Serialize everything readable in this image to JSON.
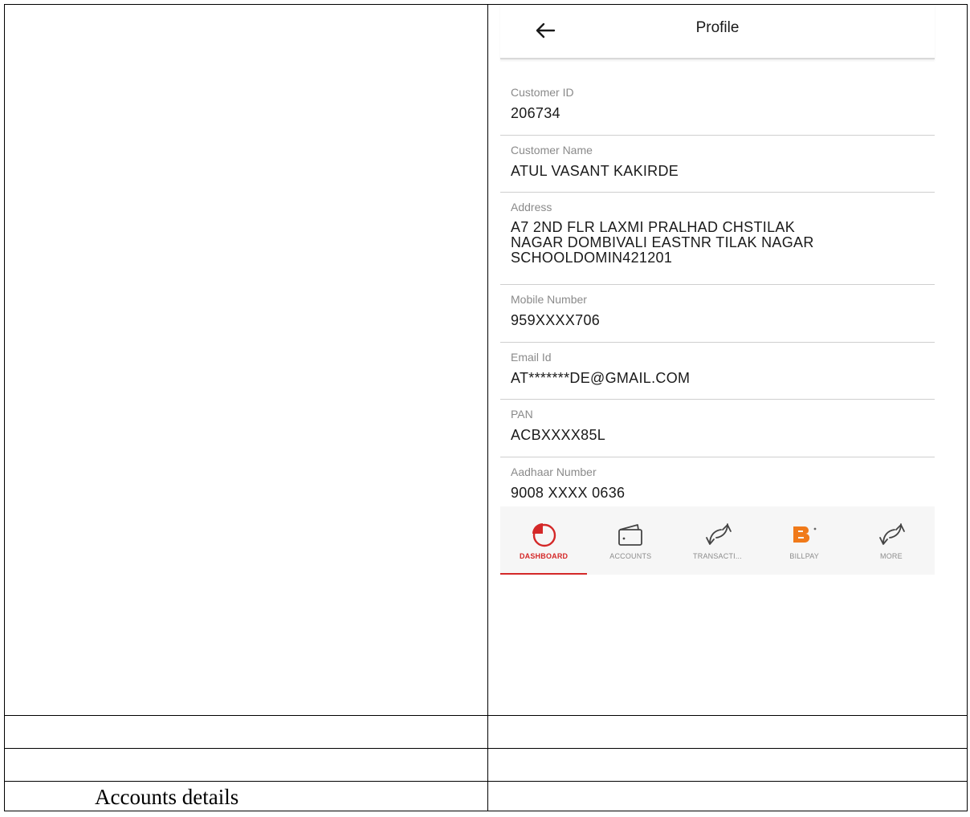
{
  "profile_screen": {
    "title": "Profile",
    "fields": [
      {
        "label": "Customer ID",
        "value": "206734"
      },
      {
        "label": "Customer Name",
        "value": "ATUL VASANT KAKIRDE"
      },
      {
        "label": "Address",
        "value": "A7 2ND FLR LAXMI PRALHAD CHSTILAK\nNAGAR DOMBIVALI EASTNR TILAK NAGAR\nSCHOOLDOMIN421201"
      },
      {
        "label": "Mobile Number",
        "value": "959XXXX706"
      },
      {
        "label": "Email Id",
        "value": "AT*******DE@GMAIL.COM"
      },
      {
        "label": "PAN",
        "value": "ACBXXXX85L"
      },
      {
        "label": "Aadhaar Number",
        "value": "9008 XXXX 0636"
      }
    ]
  },
  "bottom_nav": {
    "active_color": "#d42828",
    "items": [
      {
        "label": "DASHBOARD",
        "icon": "dashboard-pie-icon",
        "active": true
      },
      {
        "label": "ACCOUNTS",
        "icon": "wallet-icon",
        "active": false
      },
      {
        "label": "TRANSACTI...",
        "icon": "transfer-arrows-icon",
        "active": false
      },
      {
        "label": "BILLPAY",
        "icon": "billpay-b-icon",
        "active": false
      },
      {
        "label": "MORE",
        "icon": "transfer-arrows-icon",
        "active": false
      }
    ]
  },
  "document": {
    "caption": "Accounts details"
  }
}
